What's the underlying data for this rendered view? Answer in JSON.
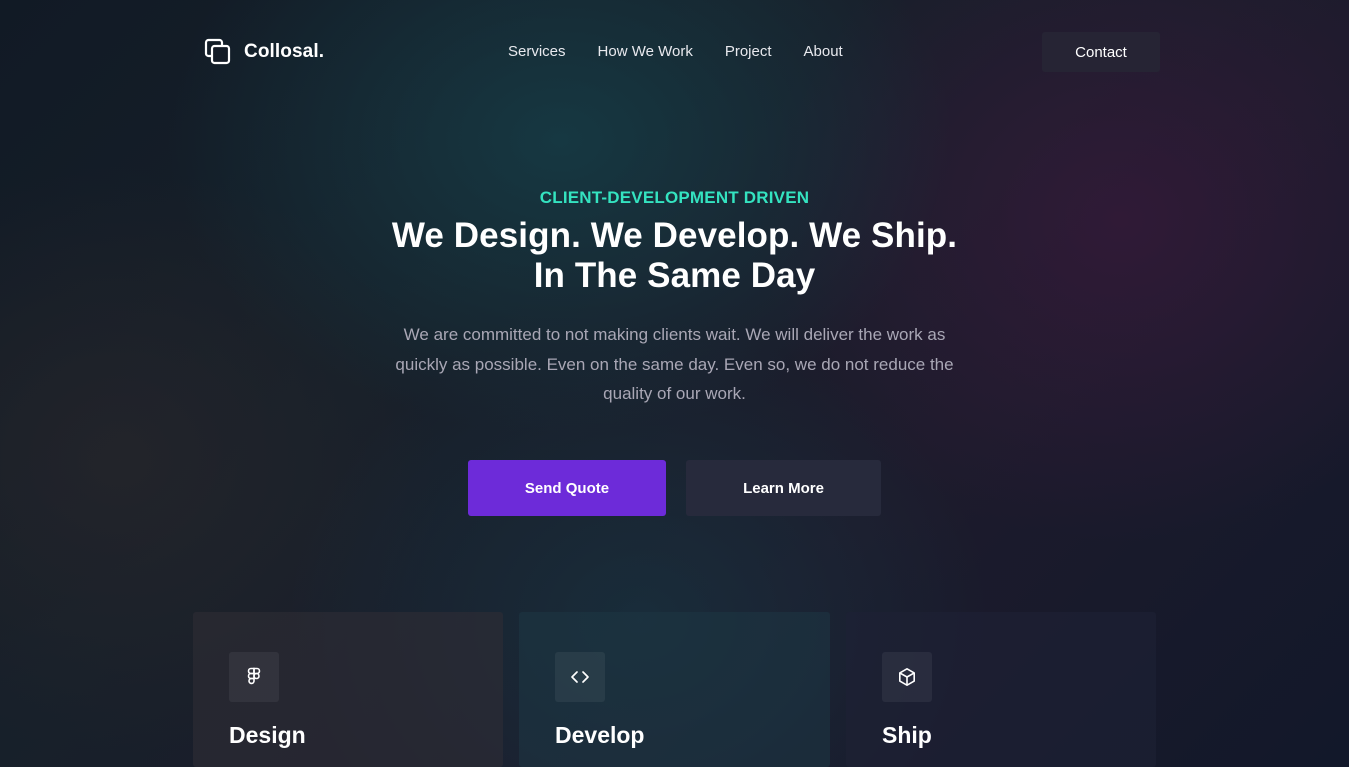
{
  "brand": {
    "name": "Collosal.",
    "icon": "copy-squares-icon"
  },
  "nav": {
    "items": [
      {
        "label": "Services"
      },
      {
        "label": "How We Work"
      },
      {
        "label": "Project"
      },
      {
        "label": "About"
      }
    ],
    "contact_label": "Contact"
  },
  "hero": {
    "eyebrow": "CLIENT-DEVELOPMENT DRIVEN",
    "headline_line1": "We Design. We Develop. We Ship.",
    "headline_line2": "In The Same Day",
    "description": "We are committed to not making clients wait. We will deliver the work as quickly as possible. Even on the same day. Even so, we do not reduce the quality of our work.",
    "primary_cta": "Send Quote",
    "secondary_cta": "Learn More"
  },
  "features": [
    {
      "title": "Design",
      "icon": "figma-icon"
    },
    {
      "title": "Develop",
      "icon": "code-brackets-icon"
    },
    {
      "title": "Ship",
      "icon": "cube-icon"
    }
  ],
  "colors": {
    "accent_teal": "#34e3c0",
    "primary_button": "#6d2bd9",
    "secondary_button": "#272a3c",
    "contact_button": "#262434",
    "body_text": "#a9a7b5"
  }
}
